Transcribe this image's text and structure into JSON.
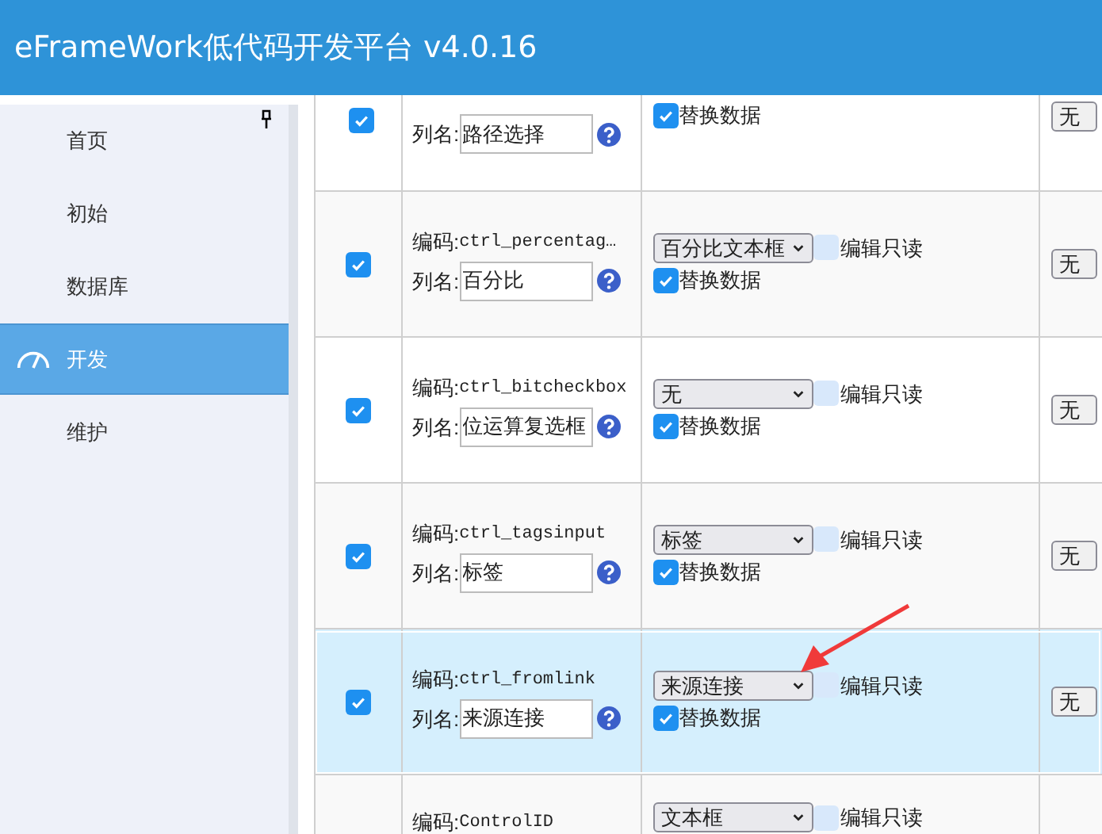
{
  "header": {
    "title": "eFrameWork低代码开发平台 v4.0.16"
  },
  "sidebar": {
    "items": [
      {
        "label": "首页",
        "selected": false
      },
      {
        "label": "初始",
        "selected": false
      },
      {
        "label": "数据库",
        "selected": false
      },
      {
        "label": "开发",
        "selected": true
      },
      {
        "label": "维护",
        "selected": false
      }
    ]
  },
  "table": {
    "rows": [
      {
        "selected": false,
        "checked": true,
        "name_label": "列名:",
        "name": "路径选择",
        "replace_label": "替换数据",
        "replace_checked": true,
        "last": "无"
      },
      {
        "selected": false,
        "checked": true,
        "code_label": "编码:",
        "code": "ctrl_percentag…",
        "name_label": "列名:",
        "name": "百分比",
        "control": "百分比文本框",
        "readonly_label": "编辑只读",
        "readonly_checked": false,
        "replace_label": "替换数据",
        "replace_checked": true,
        "last": "无"
      },
      {
        "selected": false,
        "checked": true,
        "code_label": "编码:",
        "code": "ctrl_bitcheckbox",
        "name_label": "列名:",
        "name": "位运算复选框",
        "control": "无",
        "readonly_label": "编辑只读",
        "readonly_checked": false,
        "replace_label": "替换数据",
        "replace_checked": true,
        "last": "无"
      },
      {
        "selected": false,
        "checked": true,
        "code_label": "编码:",
        "code": "ctrl_tagsinput",
        "name_label": "列名:",
        "name": "标签",
        "control": "标签",
        "readonly_label": "编辑只读",
        "readonly_checked": false,
        "replace_label": "替换数据",
        "replace_checked": true,
        "last": "无"
      },
      {
        "selected": true,
        "checked": true,
        "code_label": "编码:",
        "code": "ctrl_fromlink",
        "name_label": "列名:",
        "name": "来源连接",
        "control": "来源连接",
        "readonly_label": "编辑只读",
        "readonly_checked": false,
        "replace_label": "替换数据",
        "replace_checked": true,
        "last": "无"
      },
      {
        "selected": false,
        "code_label": "编码:",
        "code": "ControlID",
        "control": "文本框",
        "readonly_label": "编辑只读",
        "readonly_checked": false
      }
    ]
  }
}
